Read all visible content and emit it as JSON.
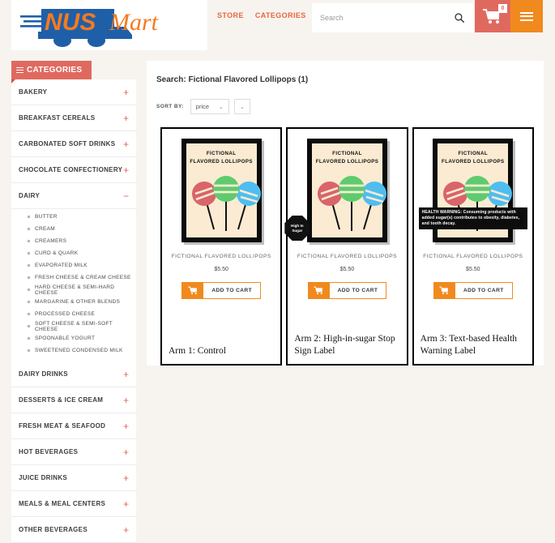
{
  "header": {
    "logo_alt": "NUSMart",
    "logo_text_primary": "NUS",
    "logo_text_secondary": "Mart",
    "nav": [
      {
        "label": "STORE"
      },
      {
        "label": "CATEGORIES"
      }
    ],
    "search": {
      "placeholder": "Search",
      "value": ""
    },
    "cart": {
      "count": "0"
    },
    "colors": {
      "logo_blue": "#1f5fa8",
      "logo_orange": "#f47b20",
      "nav_link": "#e8663f",
      "cart_bg": "#e0695f",
      "menu_bg": "#f08a1e"
    }
  },
  "sidebar": {
    "title": "CATEGORIES",
    "items": [
      {
        "label": "BAKERY",
        "toggle": "+",
        "expanded": false
      },
      {
        "label": "BREAKFAST CEREALS",
        "toggle": "+",
        "expanded": false
      },
      {
        "label": "CARBONATED SOFT DRINKS",
        "toggle": "+",
        "expanded": false
      },
      {
        "label": "CHOCOLATE CONFECTIONERY",
        "toggle": "+",
        "expanded": false
      },
      {
        "label": "DAIRY",
        "toggle": "−",
        "expanded": true
      },
      {
        "label": "DAIRY DRINKS",
        "toggle": "+",
        "expanded": false
      },
      {
        "label": "DESSERTS & ICE CREAM",
        "toggle": "+",
        "expanded": false
      },
      {
        "label": "FRESH MEAT & SEAFOOD",
        "toggle": "+",
        "expanded": false
      },
      {
        "label": "HOT BEVERAGES",
        "toggle": "+",
        "expanded": false
      },
      {
        "label": "JUICE DRINKS",
        "toggle": "+",
        "expanded": false
      },
      {
        "label": "MEALS & MEAL CENTERS",
        "toggle": "+",
        "expanded": false
      },
      {
        "label": "OTHER BEVERAGES",
        "toggle": "+",
        "expanded": false
      }
    ],
    "dairy_subitems": [
      {
        "label": "BUTTER"
      },
      {
        "label": "CREAM"
      },
      {
        "label": "CREAMERS"
      },
      {
        "label": "CURD & QUARK"
      },
      {
        "label": "EVAPORATED MILK"
      },
      {
        "label": "FRESH CHEESE  & CREAM CHEESE"
      },
      {
        "label": "HARD CHEESE  & SEMI-HARD CHEESE"
      },
      {
        "label": "MARGARINE & OTHER BLENDS"
      },
      {
        "label": "PROCESSED CHEESE"
      },
      {
        "label": "SOFT CHEESE  & SEMI-SOFT CHEESE"
      },
      {
        "label": "SPOONABLE YOGURT"
      },
      {
        "label": "SWEETENED CONDENSED MILK"
      }
    ]
  },
  "main": {
    "result_title": "Search: Fictional Flavored Lollipops (1)",
    "sort_label": "SORT BY:",
    "sort_value": "price",
    "sort_direction_value": "",
    "chevron": "⌄"
  },
  "products": [
    {
      "poster_line1": "FICTIONAL",
      "poster_line2": "FLAVORED  LOLLIPOPS",
      "name": "FICTIONAL FLAVORED LOLLIPOPS",
      "price": "$5.50",
      "add_to_cart": "ADD TO CART",
      "arm_label": "Arm 1: Control",
      "label_type": "none",
      "label_text": ""
    },
    {
      "poster_line1": "FICTIONAL",
      "poster_line2": "FLAVORED  LOLLIPOPS",
      "name": "FICTIONAL FLAVORED LOLLIPOPS",
      "price": "$5.50",
      "add_to_cart": "ADD TO CART",
      "arm_label": "Arm 2: High-in-sugar Stop Sign Label",
      "label_type": "stop-sign",
      "label_text": "High in Sugar",
      "label_line1": "High In",
      "label_line2": "Sugar"
    },
    {
      "poster_line1": "FICTIONAL",
      "poster_line2": "FLAVORED  LOLLIPOPS",
      "name": "FICTIONAL FLAVORED LOLLIPOPS",
      "price": "$5.50",
      "add_to_cart": "ADD TO CART",
      "arm_label": "Arm 3: Text-based Health Warning Label",
      "label_type": "text-warning",
      "label_text": "HEALTH WARNING: Consuming products with added sugar(s) contributes to obesity, diabetes, and tooth decay."
    }
  ],
  "palette": {
    "page_bg": "#f7f4f0",
    "pop_red": "#d9646a",
    "pop_green": "#5ecb6e",
    "pop_blue": "#4fbdf0",
    "poster_bg": "#faebd2"
  }
}
